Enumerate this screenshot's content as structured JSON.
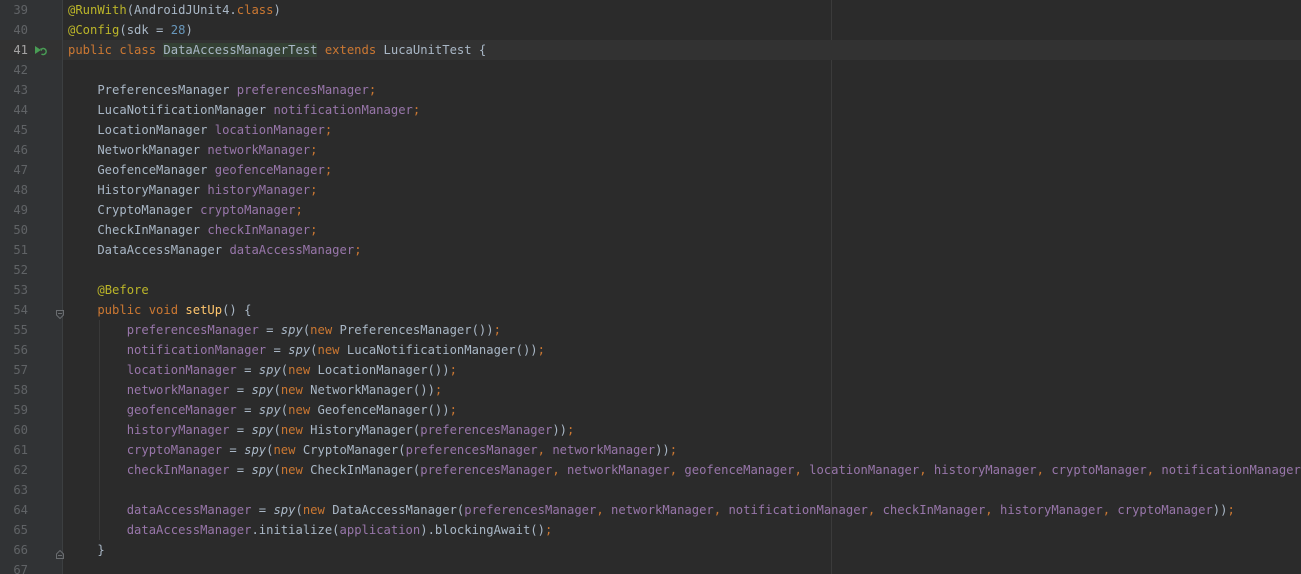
{
  "gutter": {
    "line_numbers": [
      "39",
      "40",
      "41",
      "42",
      "43",
      "44",
      "45",
      "46",
      "47",
      "48",
      "49",
      "50",
      "51",
      "52",
      "53",
      "54",
      "55",
      "56",
      "57",
      "58",
      "59",
      "60",
      "61",
      "62",
      "63",
      "64",
      "65",
      "66",
      "67"
    ],
    "current_line": "41",
    "run_icon": "run-test-icon"
  },
  "code": {
    "lines": [
      [
        {
          "t": "@RunWith",
          "c": "ann"
        },
        {
          "t": "(AndroidJUnit4.",
          "c": "pl"
        },
        {
          "t": "class",
          "c": "kw"
        },
        {
          "t": ")",
          "c": "pl"
        }
      ],
      [
        {
          "t": "@Config",
          "c": "ann"
        },
        {
          "t": "(sdk = ",
          "c": "pl"
        },
        {
          "t": "28",
          "c": "num"
        },
        {
          "t": ")",
          "c": "pl"
        }
      ],
      [
        {
          "t": "public class ",
          "c": "kw"
        },
        {
          "t": "DataAccessManagerTest",
          "c": "pl",
          "hl": true
        },
        {
          "t": " ",
          "c": "pl"
        },
        {
          "t": "extends ",
          "c": "kw"
        },
        {
          "t": "LucaUnitTest {",
          "c": "pl"
        }
      ],
      [],
      [
        {
          "t": "    PreferencesManager ",
          "c": "pl"
        },
        {
          "t": "preferencesManager",
          "c": "fld"
        },
        {
          "t": ";",
          "c": "kw"
        }
      ],
      [
        {
          "t": "    LucaNotificationManager ",
          "c": "pl"
        },
        {
          "t": "notificationManager",
          "c": "fld"
        },
        {
          "t": ";",
          "c": "kw"
        }
      ],
      [
        {
          "t": "    LocationManager ",
          "c": "pl"
        },
        {
          "t": "locationManager",
          "c": "fld"
        },
        {
          "t": ";",
          "c": "kw"
        }
      ],
      [
        {
          "t": "    NetworkManager ",
          "c": "pl"
        },
        {
          "t": "networkManager",
          "c": "fld"
        },
        {
          "t": ";",
          "c": "kw"
        }
      ],
      [
        {
          "t": "    GeofenceManager ",
          "c": "pl"
        },
        {
          "t": "geofenceManager",
          "c": "fld"
        },
        {
          "t": ";",
          "c": "kw"
        }
      ],
      [
        {
          "t": "    HistoryManager ",
          "c": "pl"
        },
        {
          "t": "historyManager",
          "c": "fld"
        },
        {
          "t": ";",
          "c": "kw"
        }
      ],
      [
        {
          "t": "    CryptoManager ",
          "c": "pl"
        },
        {
          "t": "cryptoManager",
          "c": "fld"
        },
        {
          "t": ";",
          "c": "kw"
        }
      ],
      [
        {
          "t": "    CheckInManager ",
          "c": "pl"
        },
        {
          "t": "checkInManager",
          "c": "fld"
        },
        {
          "t": ";",
          "c": "kw"
        }
      ],
      [
        {
          "t": "    DataAccessManager ",
          "c": "pl"
        },
        {
          "t": "dataAccessManager",
          "c": "fld"
        },
        {
          "t": ";",
          "c": "kw"
        }
      ],
      [],
      [
        {
          "t": "    ",
          "c": "pl"
        },
        {
          "t": "@Before",
          "c": "ann"
        }
      ],
      [
        {
          "t": "    public void ",
          "c": "kw"
        },
        {
          "t": "setUp",
          "c": "fn"
        },
        {
          "t": "() {",
          "c": "pl"
        }
      ],
      [
        {
          "t": "        ",
          "c": "pl"
        },
        {
          "t": "preferencesManager",
          "c": "fld"
        },
        {
          "t": " = ",
          "c": "pl"
        },
        {
          "t": "spy",
          "c": "st"
        },
        {
          "t": "(",
          "c": "pl"
        },
        {
          "t": "new ",
          "c": "kw"
        },
        {
          "t": "PreferencesManager())",
          "c": "pl"
        },
        {
          "t": ";",
          "c": "kw"
        }
      ],
      [
        {
          "t": "        ",
          "c": "pl"
        },
        {
          "t": "notificationManager",
          "c": "fld"
        },
        {
          "t": " = ",
          "c": "pl"
        },
        {
          "t": "spy",
          "c": "st"
        },
        {
          "t": "(",
          "c": "pl"
        },
        {
          "t": "new ",
          "c": "kw"
        },
        {
          "t": "LucaNotificationManager())",
          "c": "pl"
        },
        {
          "t": ";",
          "c": "kw"
        }
      ],
      [
        {
          "t": "        ",
          "c": "pl"
        },
        {
          "t": "locationManager",
          "c": "fld"
        },
        {
          "t": " = ",
          "c": "pl"
        },
        {
          "t": "spy",
          "c": "st"
        },
        {
          "t": "(",
          "c": "pl"
        },
        {
          "t": "new ",
          "c": "kw"
        },
        {
          "t": "LocationManager())",
          "c": "pl"
        },
        {
          "t": ";",
          "c": "kw"
        }
      ],
      [
        {
          "t": "        ",
          "c": "pl"
        },
        {
          "t": "networkManager",
          "c": "fld"
        },
        {
          "t": " = ",
          "c": "pl"
        },
        {
          "t": "spy",
          "c": "st"
        },
        {
          "t": "(",
          "c": "pl"
        },
        {
          "t": "new ",
          "c": "kw"
        },
        {
          "t": "NetworkManager())",
          "c": "pl"
        },
        {
          "t": ";",
          "c": "kw"
        }
      ],
      [
        {
          "t": "        ",
          "c": "pl"
        },
        {
          "t": "geofenceManager",
          "c": "fld"
        },
        {
          "t": " = ",
          "c": "pl"
        },
        {
          "t": "spy",
          "c": "st"
        },
        {
          "t": "(",
          "c": "pl"
        },
        {
          "t": "new ",
          "c": "kw"
        },
        {
          "t": "GeofenceManager())",
          "c": "pl"
        },
        {
          "t": ";",
          "c": "kw"
        }
      ],
      [
        {
          "t": "        ",
          "c": "pl"
        },
        {
          "t": "historyManager",
          "c": "fld"
        },
        {
          "t": " = ",
          "c": "pl"
        },
        {
          "t": "spy",
          "c": "st"
        },
        {
          "t": "(",
          "c": "pl"
        },
        {
          "t": "new ",
          "c": "kw"
        },
        {
          "t": "HistoryManager(",
          "c": "pl"
        },
        {
          "t": "preferencesManager",
          "c": "fld"
        },
        {
          "t": "))",
          "c": "pl"
        },
        {
          "t": ";",
          "c": "kw"
        }
      ],
      [
        {
          "t": "        ",
          "c": "pl"
        },
        {
          "t": "cryptoManager",
          "c": "fld"
        },
        {
          "t": " = ",
          "c": "pl"
        },
        {
          "t": "spy",
          "c": "st"
        },
        {
          "t": "(",
          "c": "pl"
        },
        {
          "t": "new ",
          "c": "kw"
        },
        {
          "t": "CryptoManager(",
          "c": "pl"
        },
        {
          "t": "preferencesManager",
          "c": "fld"
        },
        {
          "t": ", ",
          "c": "kw"
        },
        {
          "t": "networkManager",
          "c": "fld"
        },
        {
          "t": "))",
          "c": "pl"
        },
        {
          "t": ";",
          "c": "kw"
        }
      ],
      [
        {
          "t": "        ",
          "c": "pl"
        },
        {
          "t": "checkInManager",
          "c": "fld"
        },
        {
          "t": " = ",
          "c": "pl"
        },
        {
          "t": "spy",
          "c": "st"
        },
        {
          "t": "(",
          "c": "pl"
        },
        {
          "t": "new ",
          "c": "kw"
        },
        {
          "t": "CheckInManager(",
          "c": "pl"
        },
        {
          "t": "preferencesManager",
          "c": "fld"
        },
        {
          "t": ", ",
          "c": "kw"
        },
        {
          "t": "networkManager",
          "c": "fld"
        },
        {
          "t": ", ",
          "c": "kw"
        },
        {
          "t": "geofenceManager",
          "c": "fld"
        },
        {
          "t": ", ",
          "c": "kw"
        },
        {
          "t": "locationManager",
          "c": "fld"
        },
        {
          "t": ", ",
          "c": "kw"
        },
        {
          "t": "historyManager",
          "c": "fld"
        },
        {
          "t": ", ",
          "c": "kw"
        },
        {
          "t": "cryptoManager",
          "c": "fld"
        },
        {
          "t": ", ",
          "c": "kw"
        },
        {
          "t": "notificationManager",
          "c": "fld"
        },
        {
          "t": "))",
          "c": "pl"
        },
        {
          "t": ";",
          "c": "kw"
        }
      ],
      [],
      [
        {
          "t": "        ",
          "c": "pl"
        },
        {
          "t": "dataAccessManager",
          "c": "fld"
        },
        {
          "t": " = ",
          "c": "pl"
        },
        {
          "t": "spy",
          "c": "st"
        },
        {
          "t": "(",
          "c": "pl"
        },
        {
          "t": "new ",
          "c": "kw"
        },
        {
          "t": "DataAccessManager(",
          "c": "pl"
        },
        {
          "t": "preferencesManager",
          "c": "fld"
        },
        {
          "t": ", ",
          "c": "kw"
        },
        {
          "t": "networkManager",
          "c": "fld"
        },
        {
          "t": ", ",
          "c": "kw"
        },
        {
          "t": "notificationManager",
          "c": "fld"
        },
        {
          "t": ", ",
          "c": "kw"
        },
        {
          "t": "checkInManager",
          "c": "fld"
        },
        {
          "t": ", ",
          "c": "kw"
        },
        {
          "t": "historyManager",
          "c": "fld"
        },
        {
          "t": ", ",
          "c": "kw"
        },
        {
          "t": "cryptoManager",
          "c": "fld"
        },
        {
          "t": "))",
          "c": "pl"
        },
        {
          "t": ";",
          "c": "kw"
        }
      ],
      [
        {
          "t": "        ",
          "c": "pl"
        },
        {
          "t": "dataAccessManager",
          "c": "fld"
        },
        {
          "t": ".initialize(",
          "c": "pl"
        },
        {
          "t": "application",
          "c": "fld"
        },
        {
          "t": ").blockingAwait()",
          "c": "pl"
        },
        {
          "t": ";",
          "c": "kw"
        }
      ],
      [
        {
          "t": "    }",
          "c": "pl"
        }
      ],
      []
    ]
  },
  "colors": {
    "background": "#2b2b2b",
    "gutter": "#313335",
    "keyword": "#cc7832",
    "annotation": "#bbb529",
    "field": "#9876aa",
    "number": "#6897bb",
    "method": "#ffc66d",
    "plain": "#a9b7c6",
    "line_number": "#606366"
  }
}
